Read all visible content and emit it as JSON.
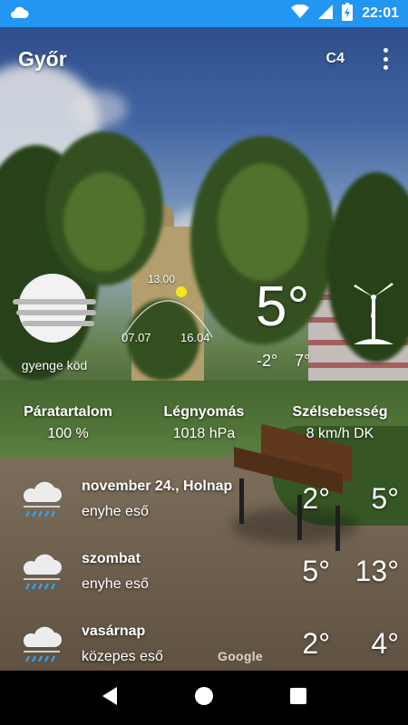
{
  "status_bar": {
    "time": "22:01",
    "icons": [
      "cloud-icon",
      "wifi-icon",
      "signal-icon",
      "battery-charging-icon"
    ],
    "color": "#2196f3"
  },
  "app_bar": {
    "city": "Győr",
    "unit": "C4",
    "menu_icon": "more-vert-icon"
  },
  "current": {
    "condition": "gyenge köd",
    "condition_icon": "fog-icon",
    "sun": {
      "noon": "13.00",
      "sunrise": "07.07",
      "sunset": "16.04"
    },
    "temperature": "5°",
    "min": "-2°",
    "max": "7°",
    "wind_icon": "wind-turbine-icon"
  },
  "stats": [
    {
      "label": "Páratartalom",
      "value": "100 %"
    },
    {
      "label": "Légnyomás",
      "value": "1018 hPa"
    },
    {
      "label": "Szélsebesség",
      "value": "8 km/h DK"
    }
  ],
  "forecast": [
    {
      "day": "november 24., Holnap",
      "desc": "enyhe eső",
      "min": "2°",
      "max": "5°",
      "icon": "rain-cloud-icon"
    },
    {
      "day": "szombat",
      "desc": "enyhe eső",
      "min": "5°",
      "max": "13°",
      "icon": "rain-cloud-icon"
    },
    {
      "day": "vasárnap",
      "desc": "közepes eső",
      "min": "2°",
      "max": "4°",
      "icon": "rain-cloud-icon"
    }
  ],
  "attribution": "Google",
  "nav": {
    "back_icon": "back-icon",
    "home_icon": "home-icon",
    "recents_icon": "recents-icon"
  }
}
